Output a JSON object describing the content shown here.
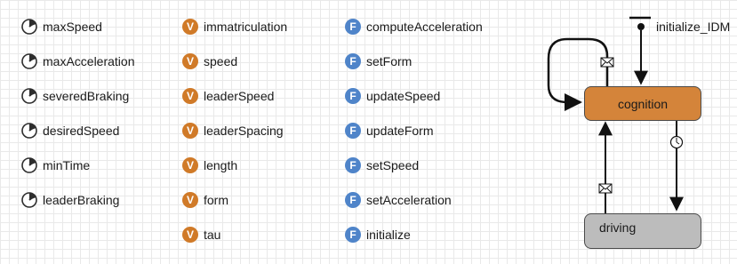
{
  "parameters": [
    "maxSpeed",
    "maxAcceleration",
    "severedBraking",
    "desiredSpeed",
    "minTime",
    "leaderBraking"
  ],
  "variables": {
    "badge": "V",
    "names": [
      "immatriculation",
      "speed",
      "leaderSpeed",
      "leaderSpacing",
      "length",
      "form",
      "tau"
    ]
  },
  "functions": {
    "badge": "F",
    "names": [
      "computeAcceleration",
      "setForm",
      "updateSpeed",
      "updateForm",
      "setSpeed",
      "setAcceleration",
      "initialize"
    ]
  },
  "statechart": {
    "initial_label": "initialize_IDM",
    "states": [
      {
        "name": "cognition",
        "color": "#d4843a"
      },
      {
        "name": "driving",
        "color": "#bcbcbc"
      }
    ],
    "transition_icons": [
      "message-icon",
      "timer-icon"
    ]
  },
  "colors": {
    "variable_badge": "#d07a28",
    "function_badge": "#4f84c9",
    "parameter_icon": "#2d2d2d"
  }
}
